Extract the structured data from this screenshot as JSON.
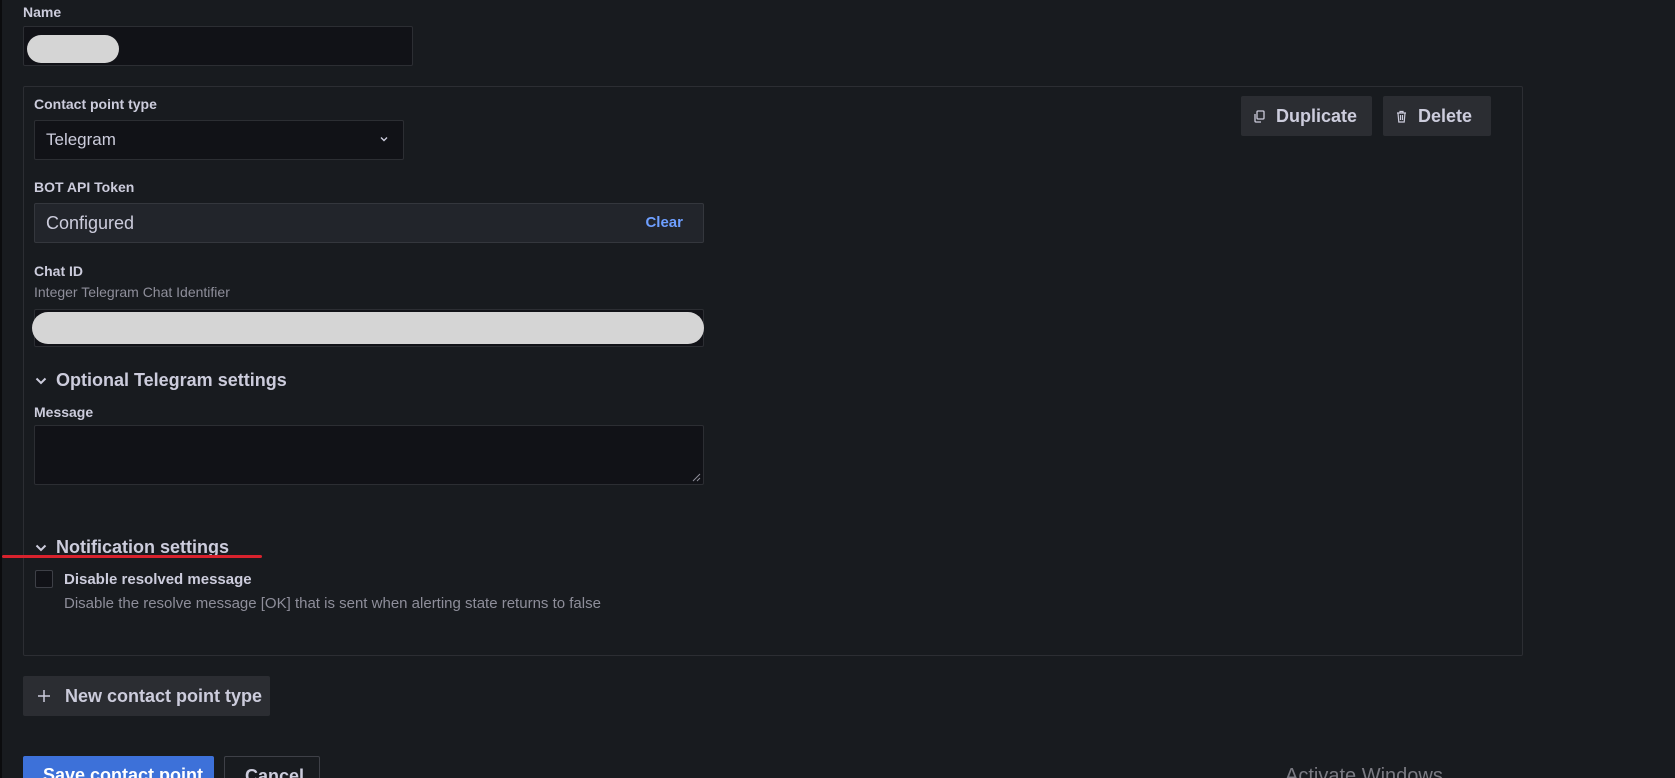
{
  "form": {
    "name_label": "Name",
    "name_value": ""
  },
  "contact_point": {
    "type_label": "Contact point type",
    "type_value": "Telegram",
    "duplicate_label": "Duplicate",
    "delete_label": "Delete",
    "bot_token_label": "BOT API Token",
    "bot_token_value": "Configured",
    "clear_label": "Clear",
    "chat_id_label": "Chat ID",
    "chat_id_description": "Integer Telegram Chat Identifier",
    "chat_id_value": "",
    "optional_section_label": "Optional Telegram settings",
    "message_label": "Message",
    "message_value": "",
    "notification_section_label": "Notification settings",
    "disable_resolved_label": "Disable resolved message",
    "disable_resolved_description": "Disable the resolve message [OK] that is sent when alerting state returns to false",
    "disable_resolved_checked": false
  },
  "actions": {
    "new_type_label": "New contact point type",
    "save_label": "Save contact point",
    "cancel_label": "Cancel"
  },
  "watermark": "Activate Windows",
  "colors": {
    "background": "#181b1f",
    "input_background": "#111217",
    "primary": "#3d71d9",
    "link": "#6e9fff",
    "annotation_red": "#d8222d"
  },
  "icons": [
    "chevron-down-icon",
    "duplicate-icon",
    "trash-icon",
    "plus-icon"
  ]
}
